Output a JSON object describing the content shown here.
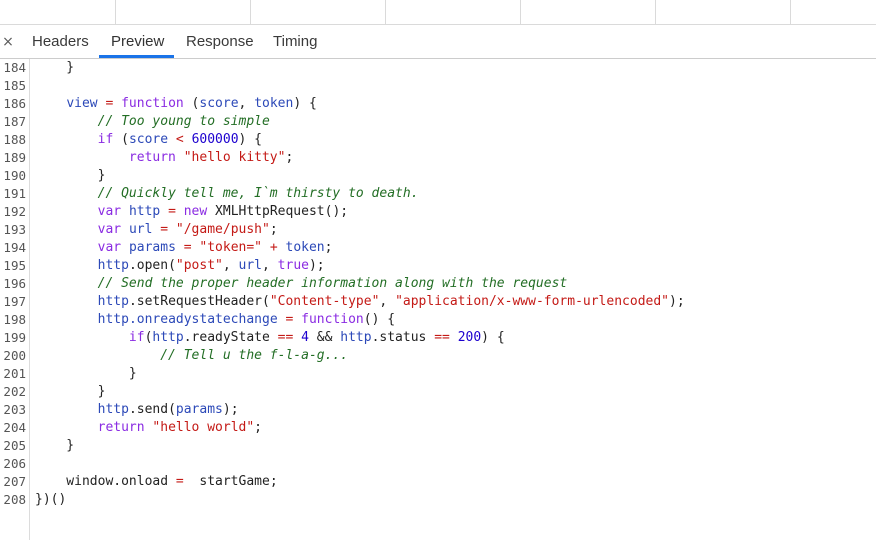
{
  "tabs": {
    "close_glyph": "×",
    "items": [
      {
        "label": "Headers"
      },
      {
        "label": "Preview"
      },
      {
        "label": "Response"
      },
      {
        "label": "Timing"
      }
    ],
    "active": "Preview"
  },
  "code": {
    "lines": [
      {
        "n": "184",
        "tokens": [
          {
            "t": "    }",
            "c": "pl"
          }
        ]
      },
      {
        "n": "185",
        "tokens": []
      },
      {
        "n": "186",
        "tokens": [
          {
            "t": "    ",
            "c": "pl"
          },
          {
            "t": "view",
            "c": "fn"
          },
          {
            "t": " = ",
            "c": "op"
          },
          {
            "t": "function",
            "c": "kw"
          },
          {
            "t": " (",
            "c": "pl"
          },
          {
            "t": "score",
            "c": "fn"
          },
          {
            "t": ", ",
            "c": "pl"
          },
          {
            "t": "token",
            "c": "fn"
          },
          {
            "t": ") {",
            "c": "pl"
          }
        ]
      },
      {
        "n": "187",
        "tokens": [
          {
            "t": "        ",
            "c": "pl"
          },
          {
            "t": "// Too young to simple",
            "c": "cm"
          }
        ]
      },
      {
        "n": "188",
        "tokens": [
          {
            "t": "        ",
            "c": "pl"
          },
          {
            "t": "if",
            "c": "kw"
          },
          {
            "t": " (",
            "c": "pl"
          },
          {
            "t": "score",
            "c": "fn"
          },
          {
            "t": " < ",
            "c": "op"
          },
          {
            "t": "600000",
            "c": "num"
          },
          {
            "t": ") {",
            "c": "pl"
          }
        ]
      },
      {
        "n": "189",
        "tokens": [
          {
            "t": "            ",
            "c": "pl"
          },
          {
            "t": "return",
            "c": "kw"
          },
          {
            "t": " ",
            "c": "pl"
          },
          {
            "t": "\"hello kitty\"",
            "c": "str"
          },
          {
            "t": ";",
            "c": "pl"
          }
        ]
      },
      {
        "n": "190",
        "tokens": [
          {
            "t": "        }",
            "c": "pl"
          }
        ]
      },
      {
        "n": "191",
        "tokens": [
          {
            "t": "        ",
            "c": "pl"
          },
          {
            "t": "// Quickly tell me, I`m thirsty to death.",
            "c": "cm"
          }
        ]
      },
      {
        "n": "192",
        "tokens": [
          {
            "t": "        ",
            "c": "pl"
          },
          {
            "t": "var",
            "c": "kw"
          },
          {
            "t": " ",
            "c": "pl"
          },
          {
            "t": "http",
            "c": "fn"
          },
          {
            "t": " = ",
            "c": "op"
          },
          {
            "t": "new",
            "c": "kw"
          },
          {
            "t": " XMLHttpRequest();",
            "c": "pl"
          }
        ]
      },
      {
        "n": "193",
        "tokens": [
          {
            "t": "        ",
            "c": "pl"
          },
          {
            "t": "var",
            "c": "kw"
          },
          {
            "t": " ",
            "c": "pl"
          },
          {
            "t": "url",
            "c": "fn"
          },
          {
            "t": " = ",
            "c": "op"
          },
          {
            "t": "\"/game/push\"",
            "c": "str"
          },
          {
            "t": ";",
            "c": "pl"
          }
        ]
      },
      {
        "n": "194",
        "tokens": [
          {
            "t": "        ",
            "c": "pl"
          },
          {
            "t": "var",
            "c": "kw"
          },
          {
            "t": " ",
            "c": "pl"
          },
          {
            "t": "params",
            "c": "fn"
          },
          {
            "t": " = ",
            "c": "op"
          },
          {
            "t": "\"token=\"",
            "c": "str"
          },
          {
            "t": " + ",
            "c": "op"
          },
          {
            "t": "token",
            "c": "fn"
          },
          {
            "t": ";",
            "c": "pl"
          }
        ]
      },
      {
        "n": "195",
        "tokens": [
          {
            "t": "        ",
            "c": "pl"
          },
          {
            "t": "http",
            "c": "fn"
          },
          {
            "t": ".open(",
            "c": "pl"
          },
          {
            "t": "\"post\"",
            "c": "str"
          },
          {
            "t": ", ",
            "c": "pl"
          },
          {
            "t": "url",
            "c": "fn"
          },
          {
            "t": ", ",
            "c": "pl"
          },
          {
            "t": "true",
            "c": "kw"
          },
          {
            "t": ");",
            "c": "pl"
          }
        ]
      },
      {
        "n": "196",
        "tokens": [
          {
            "t": "        ",
            "c": "pl"
          },
          {
            "t": "// Send the proper header information along with the request",
            "c": "cm"
          }
        ]
      },
      {
        "n": "197",
        "tokens": [
          {
            "t": "        ",
            "c": "pl"
          },
          {
            "t": "http",
            "c": "fn"
          },
          {
            "t": ".setRequestHeader(",
            "c": "pl"
          },
          {
            "t": "\"Content-type\"",
            "c": "str"
          },
          {
            "t": ", ",
            "c": "pl"
          },
          {
            "t": "\"application/x-www-form-urlencoded\"",
            "c": "str"
          },
          {
            "t": ");",
            "c": "pl"
          }
        ]
      },
      {
        "n": "198",
        "tokens": [
          {
            "t": "        ",
            "c": "pl"
          },
          {
            "t": "http",
            "c": "fn"
          },
          {
            "t": ".onreadystatechange",
            "c": "fn"
          },
          {
            "t": " = ",
            "c": "op"
          },
          {
            "t": "function",
            "c": "kw"
          },
          {
            "t": "() {",
            "c": "pl"
          }
        ]
      },
      {
        "n": "199",
        "tokens": [
          {
            "t": "            ",
            "c": "pl"
          },
          {
            "t": "if",
            "c": "kw"
          },
          {
            "t": "(",
            "c": "pl"
          },
          {
            "t": "http",
            "c": "fn"
          },
          {
            "t": ".readyState",
            "c": "pl"
          },
          {
            "t": " == ",
            "c": "op"
          },
          {
            "t": "4",
            "c": "num"
          },
          {
            "t": " && ",
            "c": "pl"
          },
          {
            "t": "http",
            "c": "fn"
          },
          {
            "t": ".status",
            "c": "pl"
          },
          {
            "t": " == ",
            "c": "op"
          },
          {
            "t": "200",
            "c": "num"
          },
          {
            "t": ") {",
            "c": "pl"
          }
        ]
      },
      {
        "n": "200",
        "tokens": [
          {
            "t": "                ",
            "c": "pl"
          },
          {
            "t": "// Tell u the f-l-a-g...",
            "c": "cm"
          }
        ]
      },
      {
        "n": "201",
        "tokens": [
          {
            "t": "            }",
            "c": "pl"
          }
        ]
      },
      {
        "n": "202",
        "tokens": [
          {
            "t": "        }",
            "c": "pl"
          }
        ]
      },
      {
        "n": "203",
        "tokens": [
          {
            "t": "        ",
            "c": "pl"
          },
          {
            "t": "http",
            "c": "fn"
          },
          {
            "t": ".send(",
            "c": "pl"
          },
          {
            "t": "params",
            "c": "fn"
          },
          {
            "t": ");",
            "c": "pl"
          }
        ]
      },
      {
        "n": "204",
        "tokens": [
          {
            "t": "        ",
            "c": "pl"
          },
          {
            "t": "return",
            "c": "kw"
          },
          {
            "t": " ",
            "c": "pl"
          },
          {
            "t": "\"hello world\"",
            "c": "str"
          },
          {
            "t": ";",
            "c": "pl"
          }
        ]
      },
      {
        "n": "205",
        "tokens": [
          {
            "t": "    }",
            "c": "pl"
          }
        ]
      },
      {
        "n": "206",
        "tokens": []
      },
      {
        "n": "207",
        "tokens": [
          {
            "t": "    window.onload",
            "c": "pl"
          },
          {
            "t": " = ",
            "c": "op"
          },
          {
            "t": " startGame;",
            "c": "pl"
          }
        ]
      },
      {
        "n": "208",
        "tokens": [
          {
            "t": "})()",
            "c": "pl"
          }
        ]
      }
    ]
  }
}
